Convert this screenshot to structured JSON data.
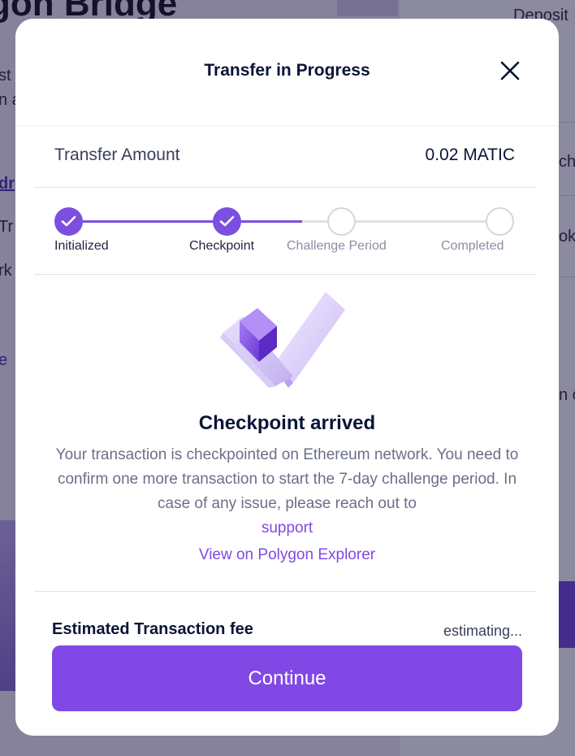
{
  "background": {
    "title": "gon Bridge",
    "side_texts": [
      "st",
      "n a",
      "dr",
      "Tr",
      "rk",
      "e"
    ],
    "right_texts": [
      "Deposit",
      "cha",
      "oke",
      "n c"
    ]
  },
  "modal": {
    "title": "Transfer in Progress",
    "close_icon": "close-icon"
  },
  "amount": {
    "label": "Transfer Amount",
    "value": "0.02 MATIC"
  },
  "stepper": {
    "steps": [
      {
        "label": "Initialized",
        "status": "done"
      },
      {
        "label": "Checkpoint",
        "status": "done"
      },
      {
        "label": "Challenge Period",
        "status": "pending"
      },
      {
        "label": "Completed",
        "status": "pending"
      }
    ]
  },
  "status": {
    "title": "Checkpoint arrived",
    "description": "Your transaction is checkpointed on Ethereum network. You need to confirm one more transaction to start the 7-day challenge period. In case of any issue, please reach out to",
    "support_link": "support",
    "explorer_link": "View on Polygon Explorer"
  },
  "fee": {
    "label": "Estimated Transaction fee",
    "value": "estimating..."
  },
  "actions": {
    "continue_label": "Continue"
  },
  "colors": {
    "accent": "#8248e5",
    "step_done": "#7c4fe0",
    "step_pending": "#d6d5de"
  }
}
